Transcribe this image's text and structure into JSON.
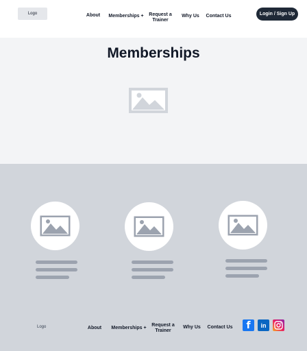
{
  "header": {
    "logo": "Logo",
    "nav": {
      "about": "About",
      "memberships": "Memberships +",
      "request_trainer": "Request a Trainer",
      "why_us": "Why Us",
      "contact_us": "Contact Us"
    },
    "login_label": "Login / Sign Up"
  },
  "hero": {
    "title": "Memberships",
    "image_icon": "image-placeholder-icon"
  },
  "cards": [
    {
      "image_icon": "image-placeholder-icon"
    },
    {
      "image_icon": "image-placeholder-icon"
    },
    {
      "image_icon": "image-placeholder-icon"
    }
  ],
  "footer": {
    "logo": "Logo",
    "nav": {
      "about": "About",
      "memberships": "Memberships +",
      "request_trainer": "Request a Trainer",
      "why_us": "Why Us",
      "contact_us": "Contact Us"
    },
    "social": {
      "facebook": "f",
      "linkedin": "in"
    }
  },
  "colors": {
    "dark": "#1f2937",
    "hero_bg": "#f3f4f6",
    "cards_bg": "#d1d5db",
    "placeholder_gray": "#9ca3af",
    "facebook_blue": "#1877f2",
    "linkedin_blue": "#0a66c2"
  }
}
